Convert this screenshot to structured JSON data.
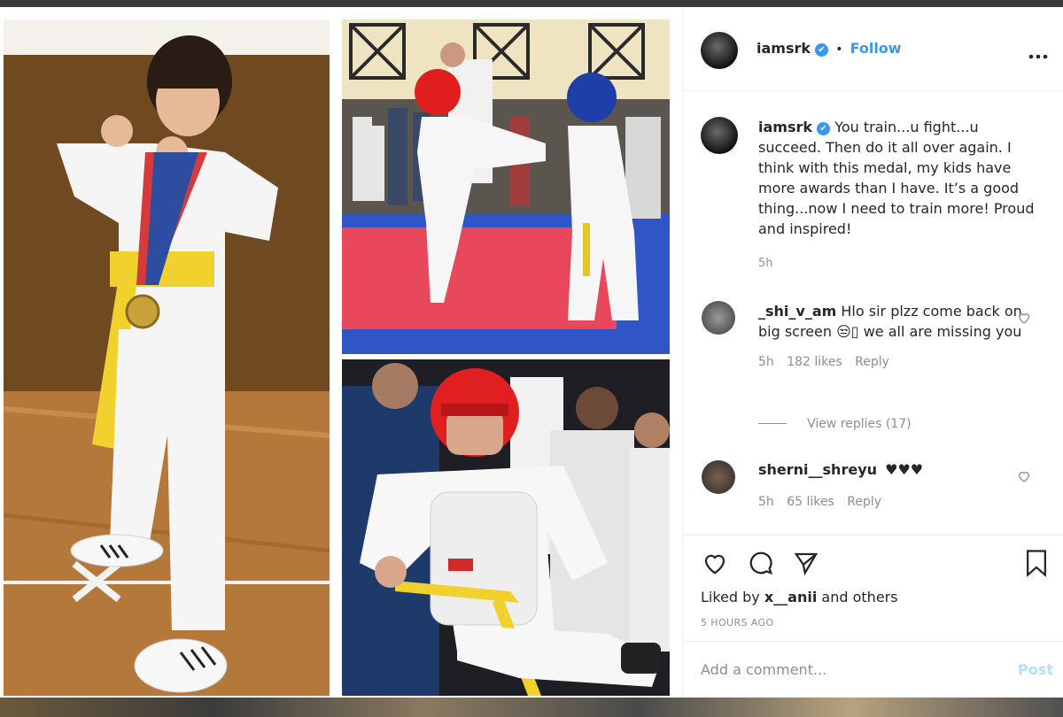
{
  "author": {
    "username": "iamsrk",
    "verified_badge": "✔",
    "follow_label": "Follow",
    "separator": "•",
    "more_icon": "more-horizontal-icon"
  },
  "caption": {
    "username": "iamsrk",
    "text": "You train...u fight...u succeed. Then do it all over again. I think with this medal, my kids have more awards than I have. It’s a good thing...now I need to train more! Proud and inspired!",
    "time": "5h"
  },
  "comments": [
    {
      "username": "_shi_v_am",
      "text": "Hlo sir plzz come back on big screen 😒▯ we all are missing you",
      "time": "5h",
      "likes": "182 likes",
      "reply": "Reply",
      "view_replies": "View replies (17)"
    },
    {
      "username": "sherni__shreyu",
      "text": "♥♥♥",
      "time": "5h",
      "likes": "65 likes",
      "reply": "Reply"
    }
  ],
  "liked_by": {
    "prefix": "Liked by ",
    "user": "x__anii",
    "suffix": " and others"
  },
  "timestamp": "5 HOURS AGO",
  "add_comment": {
    "placeholder": "Add a comment...",
    "post_label": "Post"
  },
  "colors": {
    "accent": "#3897f0",
    "text": "#262626",
    "muted": "#8e8e8e"
  }
}
